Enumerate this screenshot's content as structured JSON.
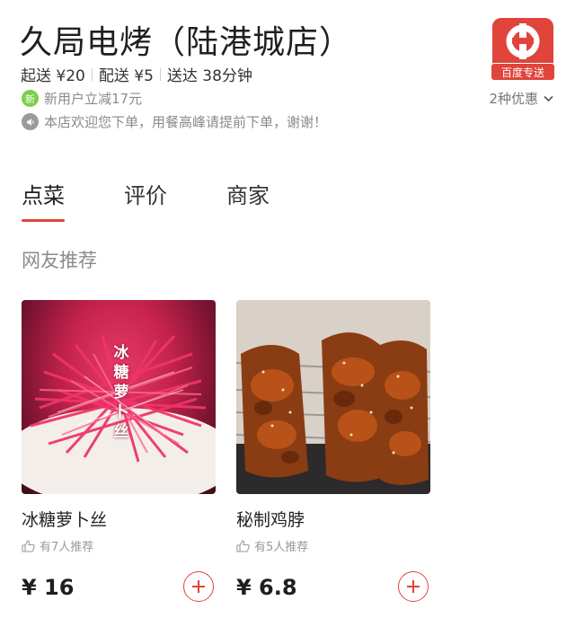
{
  "shop": {
    "name": "久局电烤（陆港城店）",
    "min_order": "起送 ¥20",
    "delivery_fee": "配送 ¥5",
    "eta": "送达 38分钟",
    "badge_new": "新",
    "new_user_promo": "新用户立减17元",
    "notice": "本店欢迎您下单，用餐高峰请提前下单，谢谢！",
    "offers": "2种优惠",
    "logo_label": "百度专送"
  },
  "tabs": [
    {
      "label": "点菜",
      "active": true
    },
    {
      "label": "评价",
      "active": false
    },
    {
      "label": "商家",
      "active": false
    }
  ],
  "section": {
    "title": "网友推荐"
  },
  "items": [
    {
      "name": "冰糖萝卜丝",
      "image_text": "冰糖萝卜丝",
      "recommend": "有7人推荐",
      "price": "¥ 16"
    },
    {
      "name": "秘制鸡脖",
      "recommend": "有5人推荐",
      "price": "¥ 6.8"
    }
  ],
  "colors": {
    "accent": "#e0443a",
    "new_badge": "#7fcd4a"
  }
}
